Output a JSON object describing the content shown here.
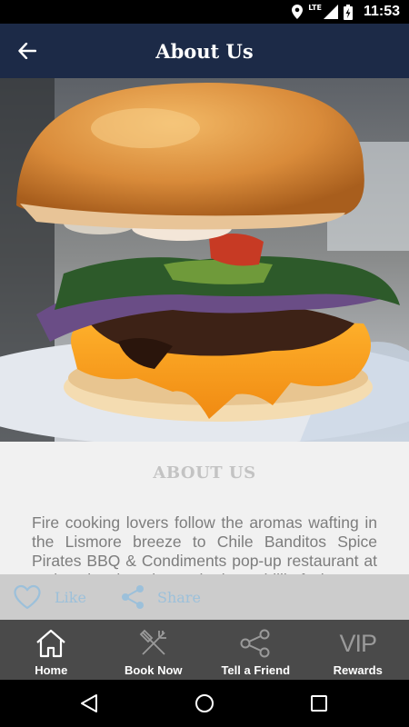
{
  "status_bar": {
    "time": "11:53",
    "network": "LTE",
    "icons": [
      "location-icon",
      "signal-icon",
      "battery-icon"
    ]
  },
  "app_bar": {
    "title": "About Us",
    "back_icon": "arrow-left-icon",
    "background": "#1c2a47"
  },
  "hero": {
    "subject": "burger photo"
  },
  "content": {
    "heading": "ABOUT US",
    "paragraph": "Fire cooking lovers follow the aromas wafting in the Lismore breeze to Chile Banditos Spice Pirates BBQ & Condiments pop-up restaurant at various local markets. The best chilli of what"
  },
  "actions": {
    "like_label": "Like",
    "share_label": "Share",
    "accent": "#9cc0da"
  },
  "bottom_nav": {
    "items": [
      {
        "label": "Home",
        "icon": "home-icon"
      },
      {
        "label": "Book Now",
        "icon": "fork-knife-icon"
      },
      {
        "label": "Tell a Friend",
        "icon": "share-icon"
      },
      {
        "label": "Rewards",
        "icon": "vip-icon",
        "icon_text": "VIP"
      }
    ],
    "background": "#4a4a4a"
  },
  "system_nav": {
    "buttons": [
      "back-triangle-icon",
      "home-circle-icon",
      "recents-square-icon"
    ]
  }
}
